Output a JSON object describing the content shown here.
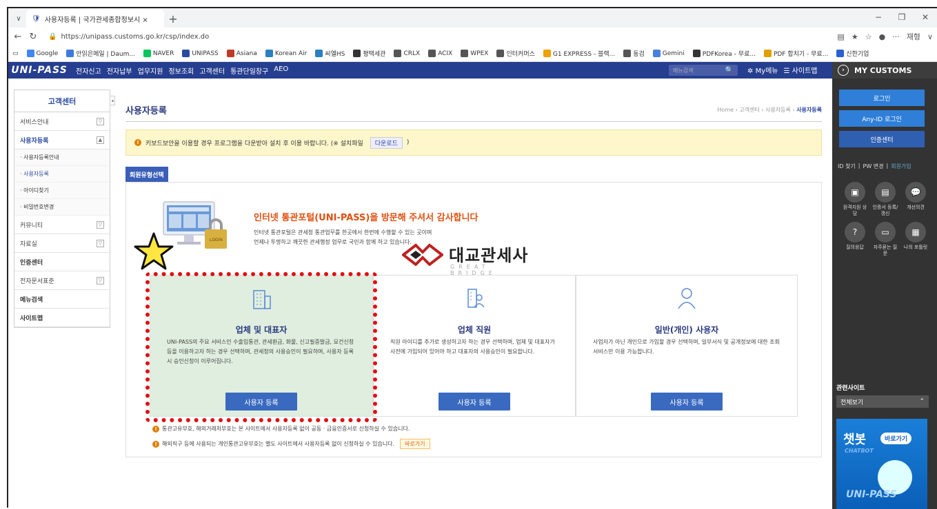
{
  "browser": {
    "tab_title": "사용자등록 | 국가관세종합정보시 ×",
    "url": "https://unipass.customs.go.kr/csp/index.do",
    "profile_label": "재형",
    "bookmarks": [
      {
        "label": "Google",
        "color": "#4285f4"
      },
      {
        "label": "안읽은메일 | Daum...",
        "color": "#3d7be0"
      },
      {
        "label": "NAVER",
        "color": "#03c75a"
      },
      {
        "label": "UNIPASS",
        "color": "#2a4aa0"
      },
      {
        "label": "Asiana",
        "color": "#c0392b"
      },
      {
        "label": "Korean Air",
        "color": "#2a80c0"
      },
      {
        "label": "씨엘HS",
        "color": "#2a80c0"
      },
      {
        "label": "평택세관",
        "color": "#333333"
      },
      {
        "label": "CRLX",
        "color": "#555555"
      },
      {
        "label": "ACIX",
        "color": "#555555"
      },
      {
        "label": "WPEX",
        "color": "#555555"
      },
      {
        "label": "인터커머스",
        "color": "#555555"
      },
      {
        "label": "G1 EXPRESS - 블랙...",
        "color": "#f0a000"
      },
      {
        "label": "동검",
        "color": "#555555"
      },
      {
        "label": "Gemini",
        "color": "#4a7fe0"
      },
      {
        "label": "PDFKorea - 무료...",
        "color": "#333333"
      },
      {
        "label": "PDF 합치기 - 무료...",
        "color": "#e0a000"
      },
      {
        "label": "신한기업",
        "color": "#2a60d0"
      }
    ]
  },
  "site": {
    "logo": "UNI-PASS",
    "gnav": [
      "전자신고",
      "전자납부",
      "업무지원",
      "정보조회",
      "고객센터",
      "통관단일창구",
      "AEO"
    ],
    "search_placeholder": "메뉴검색",
    "mymenu": "My메뉴",
    "sitemap": "사이트맵",
    "mycustoms": "MY CUSTOMS"
  },
  "lnb": {
    "title": "고객센터",
    "items": [
      {
        "label": "서비스안내",
        "type": "item"
      },
      {
        "label": "사용자등록",
        "type": "item-on"
      },
      {
        "label": "· 사용자등록안내",
        "type": "sub"
      },
      {
        "label": "· 사용자등록",
        "type": "sub-on"
      },
      {
        "label": "· 아이디찾기",
        "type": "sub"
      },
      {
        "label": "· 비밀번호변경",
        "type": "sub"
      },
      {
        "label": "커뮤니티",
        "type": "item"
      },
      {
        "label": "자료실",
        "type": "item"
      },
      {
        "label": "인증센터",
        "type": "bold"
      },
      {
        "label": "전자문서표준",
        "type": "item"
      },
      {
        "label": "메뉴검색",
        "type": "bold"
      },
      {
        "label": "사이트맵",
        "type": "bold"
      }
    ]
  },
  "page": {
    "title": "사용자등록",
    "breadcrumb": [
      "Home",
      "고객센터",
      "사용자등록",
      "사용자등록"
    ],
    "notice": "키보드보안을 이용할 경우 프로그램을 다운받아 설치 후 이용 바랍니다. (※ 설치파일",
    "notice_download": "다운로드",
    "notice_end": ")",
    "member_tab": "회원유형선택",
    "promo_title": "인터넷 통관포털(UNI-PASS)을 방문해 주셔서 감사합니다",
    "promo_desc1": "인터넷 통관포털은 관세청 통관업무를 한곳에서 한번에 수행할 수 있는 곳이며",
    "promo_desc2": "언제나 투명하고 깨끗한 관세행정 업무로 국민과 함께 하고 있습니다.",
    "watermark": "대교관세사",
    "watermark_sub": "GREAT BRIDGE",
    "cards": [
      {
        "title": "업체 및 대표자",
        "desc": "UNI-PASS의 주요 서비스인 수출입통관, 관세환급, 화물, 신고필증발급, 요건신청 등을 이용하고자 하는 경우 선택하며, 관세청의 사용승인이 필요하며, 사용자 등록 시 승인신청이 이루어집니다.",
        "button": "사용자 등록"
      },
      {
        "title": "업체 직원",
        "desc": "직원 아이디를 추가로 생성하고자 하는 경우 선택하며, 업체 및 대표자가 사전에 가입되어 있어야 하고 대표자의 사용승인이 필요합니다.",
        "button": "사용자 등록"
      },
      {
        "title": "일반(개인) 사용자",
        "desc": "사업자가 아닌 개인으로 가입할 경우 선택하며, 일부서식 및 공개정보에 대한 조회서비스만 이용 가능합니다.",
        "button": "사용자 등록"
      }
    ],
    "foot1": "통관고유부호, 해외거래처부호는 본 사이트에서 사용자등록 없이 공동 · 금융인증서로 신청하실 수 있습니다.",
    "foot2": "해외직구 등에 사용되는 개인통관고유부호는 별도 사이트에서 사용자등록 없이 신청하실 수 있습니다.",
    "foot2_btn": "바로가기"
  },
  "right": {
    "login": "로그인",
    "anyid": "Any-ID 로그인",
    "cert": "인증센터",
    "id_find": "ID 찾기",
    "pw_change": "PW 변경",
    "join": "회원가입",
    "quick": [
      {
        "label": "원격지원 상담",
        "icon": "monitor-icon"
      },
      {
        "label": "인증서 등록/갱신",
        "icon": "certificate-icon"
      },
      {
        "label": "개선의견",
        "icon": "speech-bubble-icon"
      },
      {
        "label": "질의응답",
        "icon": "question-icon"
      },
      {
        "label": "자주묻는 질문",
        "icon": "faq-icon"
      },
      {
        "label": "나의 포틀릿",
        "icon": "portlet-icon"
      }
    ],
    "related": "관련사이트",
    "related_select": "전체보기",
    "chatbot": "챗봇",
    "chatbot_go": "바로가기",
    "chatbot_en": "CHATBOT",
    "chatbot_logo": "UNI-PASS"
  },
  "colors": {
    "header": "#263e8f",
    "accent": "#3a6ac0",
    "promo": "#e05010",
    "highlight": "#e01010"
  }
}
